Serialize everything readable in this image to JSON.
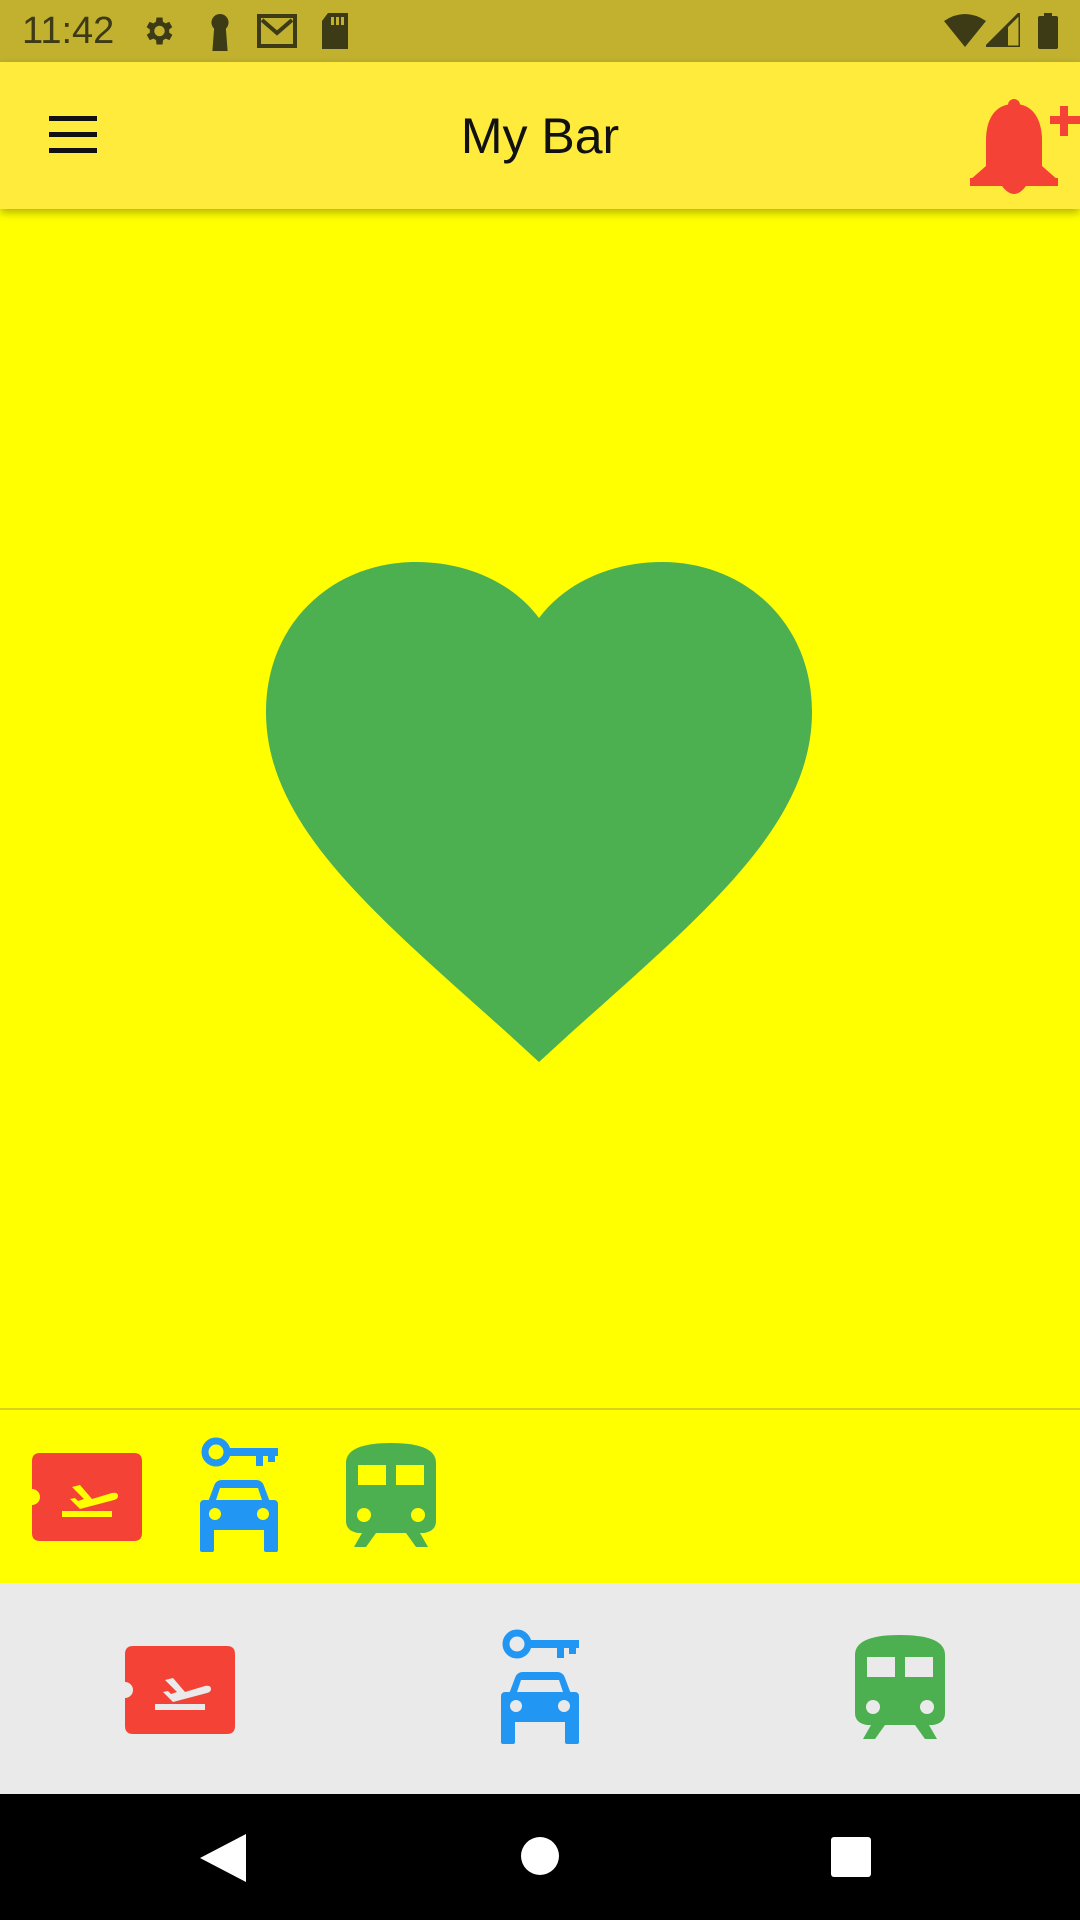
{
  "status_bar": {
    "time": "11:42",
    "icons": [
      "gear-icon",
      "keyhole-icon",
      "gmail-icon",
      "sd-card-icon",
      "wifi-icon",
      "signal-icon",
      "battery-icon"
    ]
  },
  "app_bar": {
    "title": "My Bar",
    "menu_icon": "hamburger-menu-icon",
    "action_icon": "add-alarm-icon"
  },
  "content": {
    "main_icon": "heart-icon",
    "row_icons": [
      "flight-ticket-icon",
      "car-rental-icon",
      "train-icon"
    ]
  },
  "bottom_nav": {
    "items": [
      {
        "icon": "flight-ticket-icon"
      },
      {
        "icon": "car-rental-icon"
      },
      {
        "icon": "train-icon"
      }
    ]
  },
  "colors": {
    "status_bar": "#c1b12f",
    "app_bar": "#ffeb3b",
    "background": "#ffff00",
    "heart": "#4caf50",
    "red": "#f44336",
    "blue": "#2196f3",
    "green": "#4caf50",
    "bottom_nav": "#eaeaea"
  },
  "system_nav": {
    "buttons": [
      "back-button",
      "home-button",
      "recents-button"
    ]
  }
}
